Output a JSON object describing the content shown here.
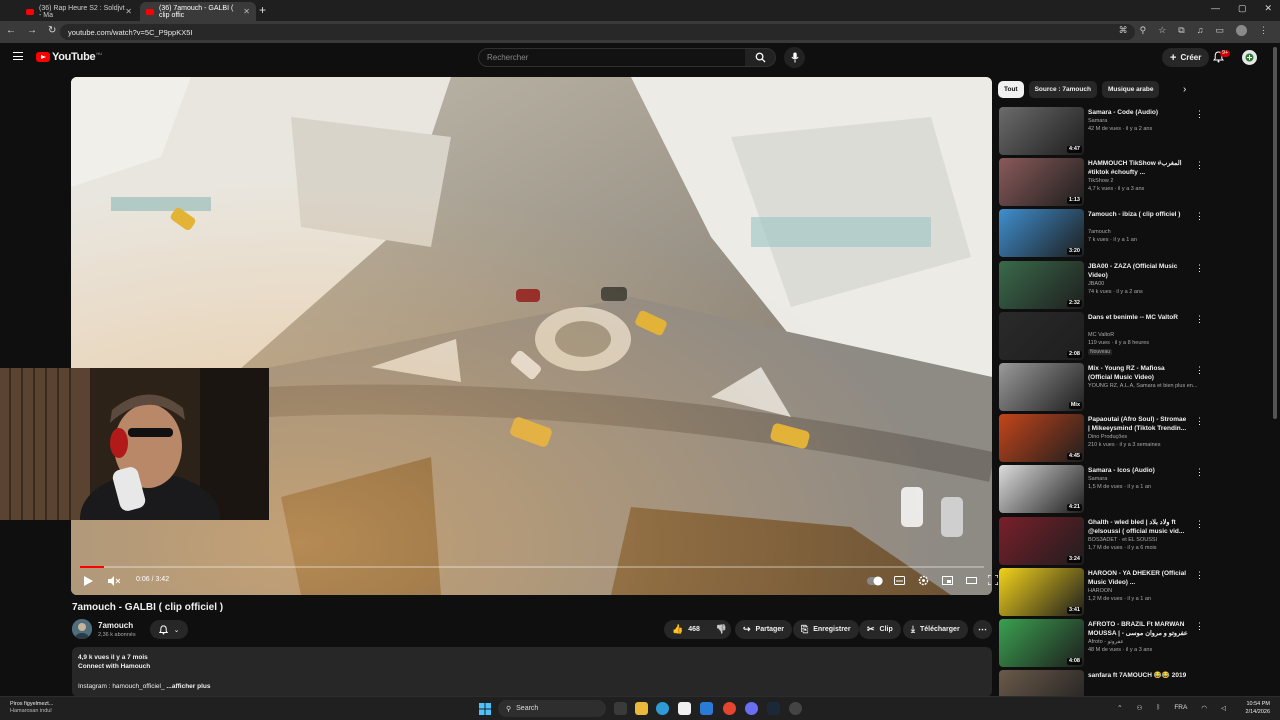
{
  "browser": {
    "tabs": [
      {
        "label": "(36) Rap Heure S2 : Soldjvt - Ma"
      },
      {
        "label": "(36) 7amouch - GALBI ( clip offic"
      }
    ],
    "url": "youtube.com/watch?v=5C_P9ppKX5I"
  },
  "masthead": {
    "logo_text": "YouTube",
    "country_code": "HU",
    "search_placeholder": "Rechercher",
    "create_label": "Créer",
    "notification_count": "9+"
  },
  "player": {
    "time_label": "0:06 / 3:42",
    "progress": 0.027
  },
  "video": {
    "title": "7amouch - GALBI ( clip officiel )",
    "channel": "7amouch",
    "subscribers": "2,36 k abonnés",
    "likes": "468",
    "share_label": "Partager",
    "save_label": "Enregistrer",
    "clip_label": "Clip",
    "download_label": "Télécharger",
    "desc_stats": "4,9 k vues  il y a 7 mois",
    "desc_line2": "Connect with Hamouch",
    "desc_line3": "Instagram : hamouch_officiel_",
    "desc_more": "...afficher plus"
  },
  "sidebar": {
    "chips": [
      "Tout",
      "Source : 7amouch",
      "Musique arabe"
    ],
    "recommendations": [
      {
        "title": "Samara - Code (Audio)",
        "channel": "Samara",
        "meta": "42 M de vues · il y a 2 ans",
        "duration": "4:47",
        "color": "#6b6b6b"
      },
      {
        "title": "HAMMOUCH TikShow #المغرب #tiktok #choufty ...",
        "channel": "TikShow 2",
        "meta": "4,7 k vues · il y a 3 ans",
        "duration": "1:13",
        "color": "#8a5a5a"
      },
      {
        "title": "7amouch - ibiza ( clip officiel )",
        "channel": "7amouch",
        "meta": "7 k vues · il y a 1 an",
        "duration": "3:20",
        "color": "#3f8fcf"
      },
      {
        "title": "JBA00 - ZAZA (Official Music Video)",
        "channel": "JBA00",
        "meta": "74 k vues · il y a 2 ans",
        "duration": "2:32",
        "color": "#3a6a4a"
      },
      {
        "title": "Dans et benimle -- MC ValtoR",
        "channel": "MC ValtoR",
        "meta": "119 vues · il y a 8 heures",
        "duration": "2:08",
        "badge": "Nouveau",
        "color": "#2a2a2a"
      },
      {
        "title": "Mix - Young RZ - Mafiosa (Official Music Video)",
        "channel": "YOUNG RZ, A.L.A, Samara et bien plus en...",
        "meta": "",
        "duration": "Mix",
        "color": "#9a9a9a"
      },
      {
        "title": "Papaoutai (Afro Soul) - Stromae | Mikeeysmind (Tiktok Trendin...",
        "channel": "Dino Produções",
        "meta": "210 k vues · il y a 3 semaines",
        "duration": "4:45",
        "color": "#c4451a"
      },
      {
        "title": "Samara - Icos (Audio)",
        "channel": "Samara",
        "meta": "1,5 M de vues · il y a 1 an",
        "duration": "4:21",
        "color": "#dcdcdc"
      },
      {
        "title": "Ghalth - wled bled | ولاد بلاد ft @elsoussi  ( official music vid...",
        "channel": "BOS3ADET · et EL SOUSSI",
        "meta": "1,7 M de vues · il y a 6 mois",
        "duration": "3:24",
        "color": "#7a1f2a"
      },
      {
        "title": "HAROON - YA DHEKER (Official Music Video) ...",
        "channel": "HAROON",
        "meta": "1,2 M de vues · il y a 1 an",
        "duration": "3:41",
        "color": "#f2d21a"
      },
      {
        "title": "AFROTO - BRAZIL Ft MARWAN MOUSSA | - عفروتو و مروان موسى",
        "channel": "Afroto - عفروتو",
        "meta": "48 M de vues · il y a 3 ans",
        "duration": "4:08",
        "color": "#3aa050"
      },
      {
        "title": "sanfara ft 7AMOUCH 😂😂 2019",
        "channel": "",
        "meta": "",
        "duration": "",
        "color": "#6a5a4a"
      }
    ]
  },
  "taskbar": {
    "weather_line1": "Piros figyelmezt...",
    "weather_line2": "Hamarosan indul",
    "search_label": "Search",
    "lang": "FRA",
    "time": "10:54 PM",
    "date": "2/14/2026"
  }
}
